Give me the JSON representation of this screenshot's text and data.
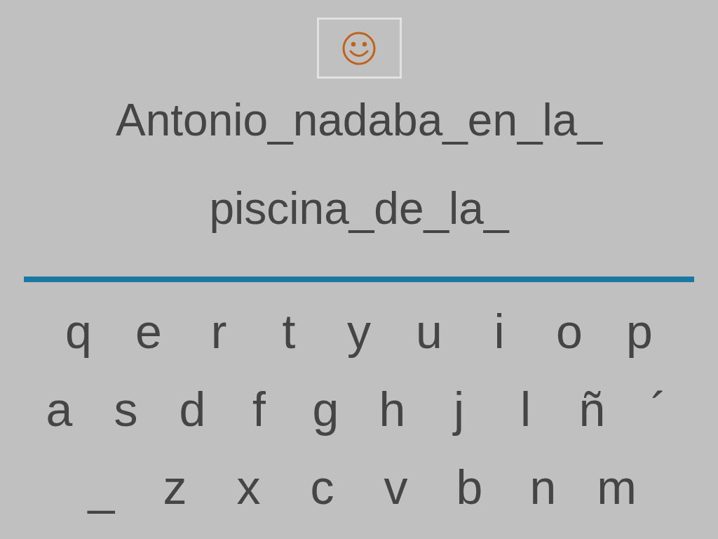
{
  "sentence_lines": [
    "Antonio_nadaba_en_la_",
    "piscina_de_la_"
  ],
  "keyboard": {
    "rows": [
      [
        "q",
        "e",
        "r",
        "t",
        "y",
        "u",
        "i",
        "o",
        "p"
      ],
      [
        "a",
        "s",
        "d",
        "f",
        "g",
        "h",
        "j",
        "l",
        "ñ",
        "´"
      ],
      [
        "_",
        "z",
        "x",
        "c",
        "v",
        "b",
        "n",
        "m"
      ]
    ]
  }
}
